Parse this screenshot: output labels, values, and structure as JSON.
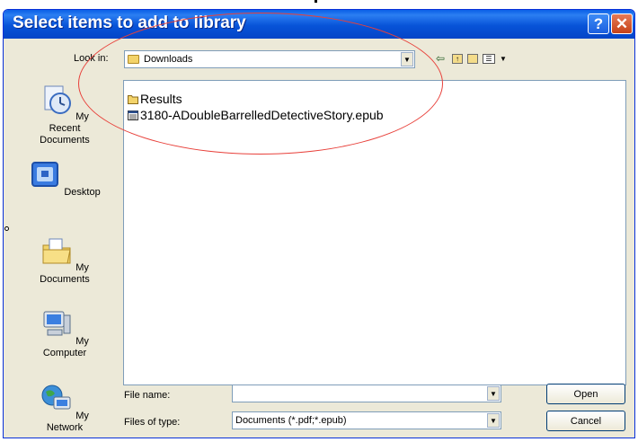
{
  "window": {
    "title": "Select items to add to library",
    "help_label": "?",
    "close_label": "✕"
  },
  "toolbar": {
    "lookin_label": "Look in:",
    "lookin_value": "Downloads",
    "icons": [
      "back-icon",
      "up-folder-icon",
      "new-folder-icon",
      "views-menu-icon"
    ]
  },
  "places": [
    {
      "label": "My Recent Documents",
      "icon": "recent-documents-icon"
    },
    {
      "label": "Desktop",
      "icon": "desktop-icon"
    },
    {
      "label": "My Documents",
      "icon": "my-documents-icon"
    },
    {
      "label": "My Computer",
      "icon": "my-computer-icon"
    },
    {
      "label": "My Network",
      "icon": "my-network-icon"
    }
  ],
  "files": [
    {
      "name": "Results",
      "icon": "folder-icon"
    },
    {
      "name": "3180-ADoubleBarrelledDetectiveStory.epub",
      "icon": "epub-file-icon"
    }
  ],
  "form": {
    "filename_label": "File name:",
    "filename_value": "",
    "filetype_label": "Files of type:",
    "filetype_value": "Documents (*.pdf;*.epub)"
  },
  "buttons": {
    "open": "Open",
    "cancel": "Cancel"
  },
  "colors": {
    "titlebar": "#0753d8",
    "dialog_bg": "#ece9d8",
    "annotation": "#e8403a",
    "close_button": "#c64218"
  }
}
